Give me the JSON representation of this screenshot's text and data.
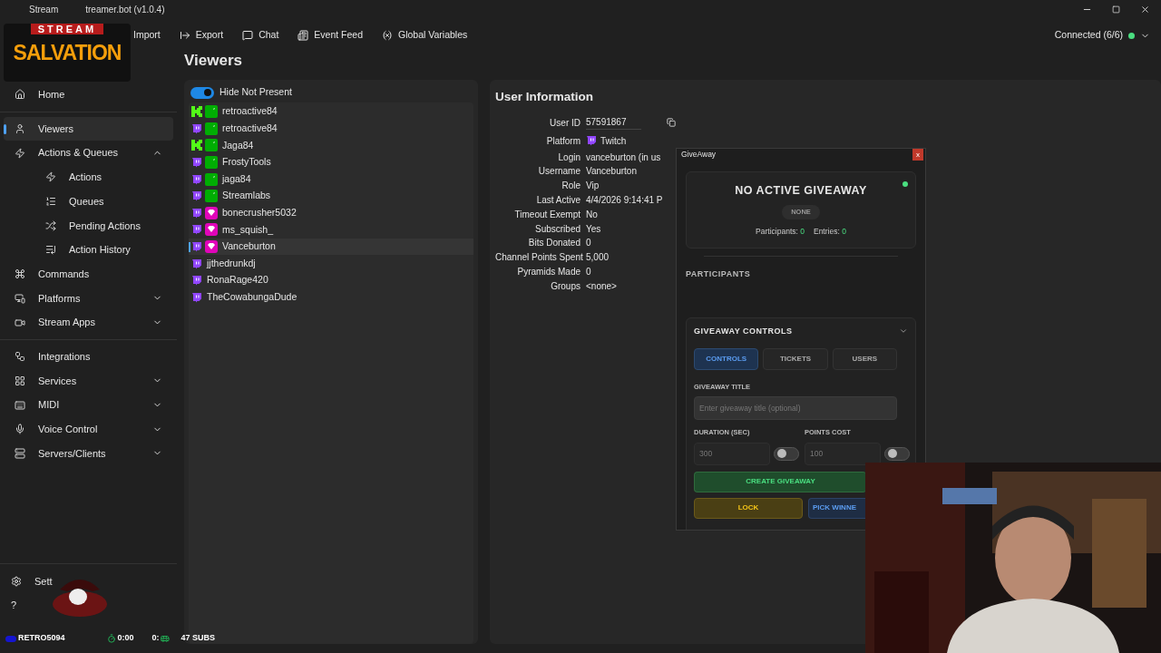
{
  "window": {
    "title_start": "Stream",
    "title_end": "treamer.bot (v1.0.4)"
  },
  "toolbar": {
    "items": [
      "Import",
      "Export",
      "Chat",
      "Event Feed",
      "Global Variables"
    ],
    "connection": "Connected (6/6)",
    "connected": true
  },
  "overlay_logo": {
    "top": "STREAM",
    "main": "SALVATION"
  },
  "sidebar": {
    "sections": [
      [
        {
          "label": "Home",
          "selected": false
        }
      ],
      [
        {
          "label": "Viewers",
          "selected": true
        },
        {
          "label": "Actions & Queues",
          "selected": false,
          "expanded": true,
          "children": [
            {
              "label": "Actions",
              "selected": false
            },
            {
              "label": "Queues",
              "selected": false
            },
            {
              "label": "Pending Actions",
              "selected": false
            },
            {
              "label": "Action History",
              "selected": false
            }
          ]
        },
        {
          "label": "Commands",
          "selected": false
        },
        {
          "label": "Platforms",
          "selected": false,
          "expanded": false
        },
        {
          "label": "Stream Apps",
          "selected": false,
          "expanded": false
        }
      ],
      [
        {
          "label": "Integrations",
          "selected": false
        },
        {
          "label": "Services",
          "selected": false,
          "expanded": false
        },
        {
          "label": "MIDI",
          "selected": false,
          "expanded": false
        },
        {
          "label": "Voice Control",
          "selected": false,
          "expanded": false
        },
        {
          "label": "Servers/Clients",
          "selected": false,
          "expanded": false
        }
      ]
    ],
    "footer": [
      {
        "label": "Sett"
      },
      {
        "label": "?"
      }
    ]
  },
  "page": {
    "title": "Viewers"
  },
  "viewers": {
    "toggle": {
      "label": "Hide Not Present",
      "on": true
    },
    "items": [
      {
        "name": "retroactive84",
        "kind": "kickmod",
        "selected": false
      },
      {
        "name": "retroactive84",
        "kind": "twitchmod",
        "selected": false
      },
      {
        "name": "Jaga84",
        "kind": "kickmod",
        "selected": false
      },
      {
        "name": "FrostyTools",
        "kind": "twitchmod",
        "selected": false
      },
      {
        "name": "jaga84",
        "kind": "twitchmod",
        "selected": false
      },
      {
        "name": "Streamlabs",
        "kind": "twitchmod",
        "selected": false
      },
      {
        "name": "bonecrusher5032",
        "kind": "twitchvip",
        "selected": false
      },
      {
        "name": "ms_squish_",
        "kind": "twitchvip",
        "selected": false
      },
      {
        "name": "Vanceburton",
        "kind": "twitchvip",
        "selected": true
      },
      {
        "name": "jjthedrunkdj",
        "kind": "twitch",
        "selected": false
      },
      {
        "name": "RonaRage420",
        "kind": "twitch",
        "selected": false
      },
      {
        "name": "TheCowabungaDude",
        "kind": "twitch",
        "selected": false
      }
    ]
  },
  "user_info": {
    "title": "User Information",
    "fields": [
      {
        "label": "User ID",
        "value": "57591867",
        "kind": "copy"
      },
      {
        "label": "Platform",
        "value": "Twitch",
        "kind": "platform"
      },
      {
        "label": "Login",
        "value": "vanceburton (in us",
        "kind": "text"
      },
      {
        "label": "Username",
        "value": "Vanceburton",
        "kind": "text"
      },
      {
        "label": "Role",
        "value": "Vip",
        "kind": "text"
      },
      {
        "label": "Last Active",
        "value": "4/4/2026 9:14:41 P",
        "kind": "text"
      },
      {
        "label": "Timeout Exempt",
        "value": "No",
        "kind": "text"
      },
      {
        "label": "Subscribed",
        "value": "Yes",
        "kind": "text"
      },
      {
        "label": "Bits Donated",
        "value": "0",
        "kind": "text"
      },
      {
        "label": "Channel Points Spent",
        "value": "5,000",
        "kind": "text"
      },
      {
        "label": "Pyramids Made",
        "value": "0",
        "kind": "text"
      },
      {
        "label": "Groups",
        "value": "<none>",
        "kind": "text"
      }
    ]
  },
  "giveaway": {
    "title": "GiveAway",
    "close": "x",
    "status_title": "NO ACTIVE GIVEAWAY",
    "live": true,
    "status": "NONE",
    "stats": [
      {
        "label": "Participants:",
        "value": "0"
      },
      {
        "label": "Entries:",
        "value": "0"
      }
    ],
    "participants_heading": "PARTICIPANTS",
    "controls_heading": "GIVEAWAY CONTROLS",
    "controls_expanded": true,
    "tabs": [
      {
        "label": "CONTROLS",
        "selected": true
      },
      {
        "label": "TICKETS",
        "selected": false
      },
      {
        "label": "USERS",
        "selected": false
      }
    ],
    "title_field": {
      "label": "GIVEAWAY TITLE",
      "placeholder": "Enter giveaway title (optional)"
    },
    "number_fields": [
      {
        "label": "DURATION (SEC)",
        "placeholder": "300",
        "on": false
      },
      {
        "label": "POINTS COST",
        "placeholder": "100",
        "on": false
      }
    ],
    "buttons": [
      {
        "label": "CREATE GIVEAWAY",
        "kind": "create"
      },
      {
        "label": "LOCK",
        "kind": "lock"
      },
      {
        "label": "PICK WINNE",
        "kind": "pick"
      }
    ]
  },
  "status_overlay": {
    "name": "RETRO5094",
    "timer": "0:00",
    "queue": "0:",
    "subs": "47 SUBS"
  }
}
